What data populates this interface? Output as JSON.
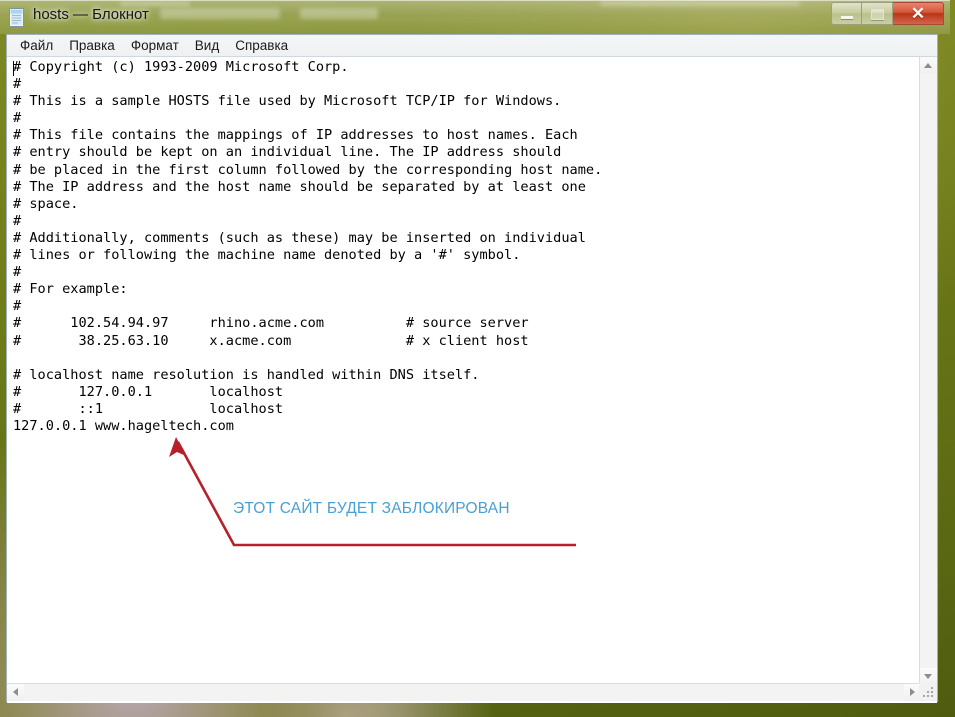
{
  "window": {
    "title": "hosts — Блокнот",
    "icon": "notepad-icon",
    "controls": {
      "minimize_label": "—",
      "maximize_label": "□",
      "close_label": "✕"
    }
  },
  "menubar": {
    "items": [
      {
        "label": "Файл"
      },
      {
        "label": "Правка"
      },
      {
        "label": "Формат"
      },
      {
        "label": "Вид"
      },
      {
        "label": "Справка"
      }
    ]
  },
  "editor": {
    "content": "# Copyright (c) 1993-2009 Microsoft Corp.\n#\n# This is a sample HOSTS file used by Microsoft TCP/IP for Windows.\n#\n# This file contains the mappings of IP addresses to host names. Each\n# entry should be kept on an individual line. The IP address should\n# be placed in the first column followed by the corresponding host name.\n# The IP address and the host name should be separated by at least one\n# space.\n#\n# Additionally, comments (such as these) may be inserted on individual\n# lines or following the machine name denoted by a '#' symbol.\n#\n# For example:\n#\n#      102.54.94.97     rhino.acme.com          # source server\n#       38.25.63.10     x.acme.com              # x client host\n\n# localhost name resolution is handled within DNS itself.\n#       127.0.0.1       localhost\n#       ::1             localhost\n127.0.0.1 www.hageltech.com",
    "lines": [
      "# Copyright (c) 1993-2009 Microsoft Corp.",
      "#",
      "# This is a sample HOSTS file used by Microsoft TCP/IP for Windows.",
      "#",
      "# This file contains the mappings of IP addresses to host names. Each",
      "# entry should be kept on an individual line. The IP address should",
      "# be placed in the first column followed by the corresponding host name.",
      "# The IP address and the host name should be separated by at least one",
      "# space.",
      "#",
      "# Additionally, comments (such as these) may be inserted on individual",
      "# lines or following the machine name denoted by a '#' symbol.",
      "#",
      "# For example:",
      "#",
      "#      102.54.94.97     rhino.acme.com          # source server",
      "#       38.25.63.10     x.acme.com              # x client host",
      "",
      "# localhost name resolution is handled within DNS itself.",
      "#       127.0.0.1       localhost",
      "#       ::1             localhost",
      "127.0.0.1 www.hageltech.com"
    ]
  },
  "annotation": {
    "caption": "ЭТОТ САЙТ БУДЕТ ЗАБЛОКИРОВАН",
    "caption_color": "#4a9fd4",
    "arrow_color": "#b5202b"
  },
  "scrollbars": {
    "vertical": {
      "up_label": "▲",
      "down_label": "▼"
    },
    "horizontal": {
      "left_label": "◄",
      "right_label": "►"
    }
  },
  "colors": {
    "desktop": "#6e7a18",
    "close_button": "#c8432a",
    "window_frame": "#9fb0bf"
  }
}
